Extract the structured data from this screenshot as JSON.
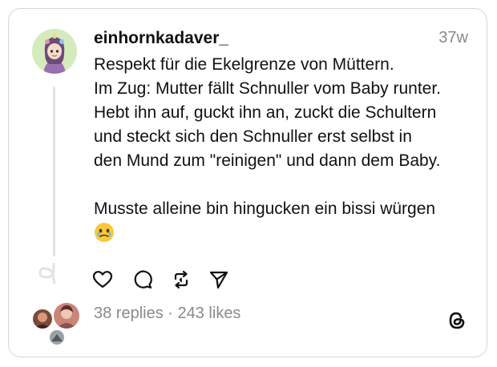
{
  "post": {
    "username": "einhornkadaver_",
    "time": "37w",
    "lines": [
      "Respekt für die Ekelgrenze von Müttern.",
      "Im Zug: Mutter fällt Schnuller vom Baby runter.",
      "Hebt ihn auf, guckt ihn an, zuckt die Schultern",
      "und steckt sich den Schnuller erst selbst in",
      "den Mund zum \"reinigen\" und dann dem Baby."
    ],
    "line2": "Musste alleine bin hingucken ein bissi würgen",
    "emoji": "face-holding-back-tears-emoji"
  },
  "actions": {
    "like": "heart-icon",
    "reply": "comment-bubble-icon",
    "repost": "repost-icon",
    "share": "send-icon"
  },
  "stats": {
    "replies": "38 replies",
    "separator": " · ",
    "likes": "243 likes"
  },
  "colors": {
    "text": "#111111",
    "muted": "#8a8a8a",
    "border": "#d7d7d7",
    "thread_line": "#e3e3e3"
  }
}
